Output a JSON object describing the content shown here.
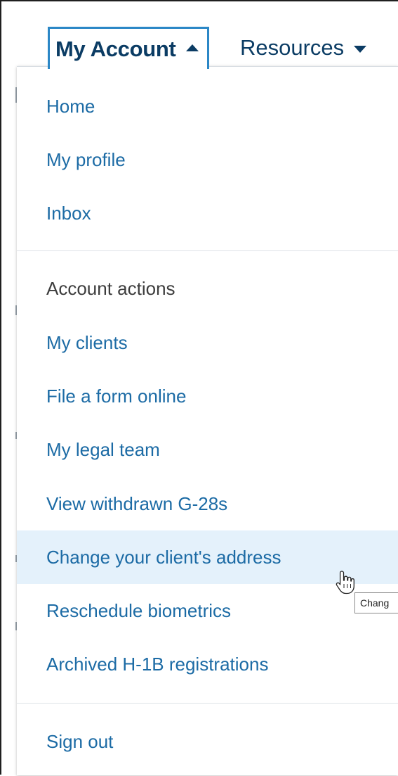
{
  "nav": {
    "my_account_label": "My Account",
    "resources_label": "Resources"
  },
  "menu": {
    "items": [
      {
        "label": "Home"
      },
      {
        "label": "My profile"
      },
      {
        "label": "Inbox"
      },
      {
        "label": "Account actions"
      },
      {
        "label": "My clients"
      },
      {
        "label": "File a form online"
      },
      {
        "label": "My legal team"
      },
      {
        "label": "View withdrawn G-28s"
      },
      {
        "label": "Change your client's address"
      },
      {
        "label": "Reschedule biometrics"
      },
      {
        "label": "Archived H-1B registrations"
      },
      {
        "label": "Sign out"
      }
    ]
  },
  "tooltip": {
    "text": "Chang"
  },
  "colors": {
    "link": "#1c6ba5",
    "nav_text": "#0b3c64",
    "active_border": "#2b87c6",
    "hover_bg": "#e4f1fb",
    "heading": "#3d3d3d"
  },
  "icons": {
    "my_account_caret": "caret-up-icon",
    "resources_caret": "caret-down-icon",
    "cursor": "hand-pointer-icon"
  }
}
